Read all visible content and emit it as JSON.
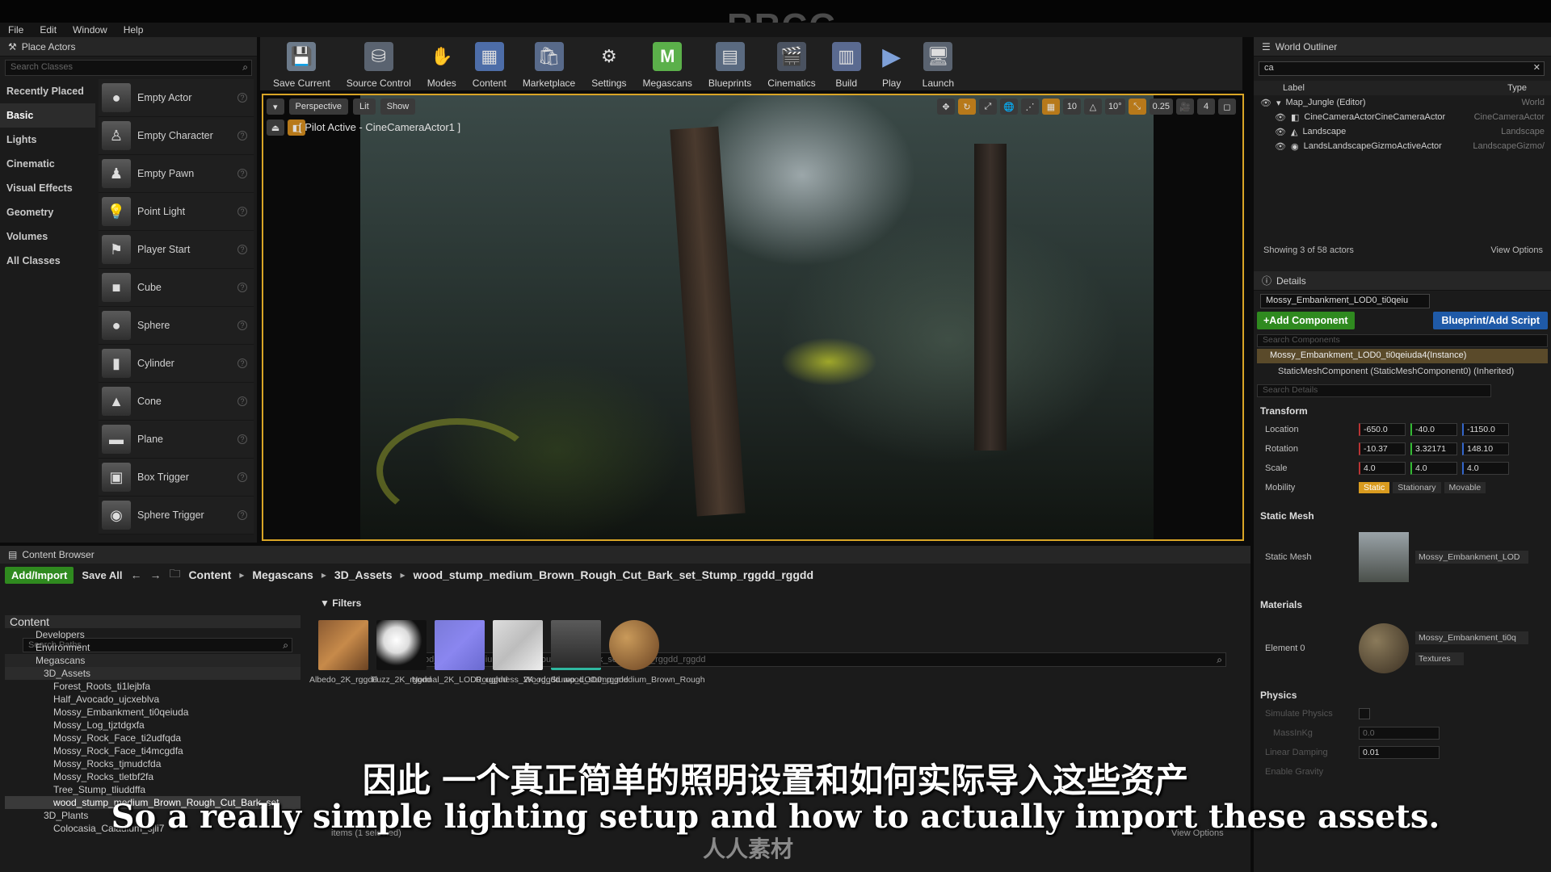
{
  "watermark": {
    "top": "RRCG",
    "bottom": "人人素材"
  },
  "menu": [
    "File",
    "Edit",
    "Window",
    "Help"
  ],
  "place_actors": {
    "title": "Place Actors",
    "search_placeholder": "Search Classes",
    "categories": [
      "Recently Placed",
      "Basic",
      "Lights",
      "Cinematic",
      "Visual Effects",
      "Geometry",
      "Volumes",
      "All Classes"
    ],
    "selected_category": "Basic",
    "actors": [
      "Empty Actor",
      "Empty Character",
      "Empty Pawn",
      "Point Light",
      "Player Start",
      "Cube",
      "Sphere",
      "Cylinder",
      "Cone",
      "Plane",
      "Box Trigger",
      "Sphere Trigger"
    ]
  },
  "toolbar": [
    "Save Current",
    "Source Control",
    "Modes",
    "Content",
    "Marketplace",
    "Settings",
    "Megascans",
    "Blueprints",
    "Cinematics",
    "Build",
    "Play",
    "Launch"
  ],
  "viewport": {
    "buttons": [
      "Perspective",
      "Lit",
      "Show"
    ],
    "pilot_text": "[ Pilot Active - CineCameraActor1 ]",
    "right_values": [
      "10",
      "10°",
      "0.25",
      "4"
    ]
  },
  "outliner": {
    "title": "World Outliner",
    "search_value": "ca",
    "col_label": "Label",
    "col_type": "Type",
    "rows": [
      {
        "label": "Map_Jungle (Editor)",
        "type": "World"
      },
      {
        "label": "CineCameraActorCineCameraActor",
        "type": "CineCameraActor"
      },
      {
        "label": "Landscape",
        "type": "Landscape"
      },
      {
        "label": "LandsLandscapeGizmoActiveActor",
        "type": "LandscapeGizmo/"
      }
    ],
    "footer": "Showing 3 of 58 actors",
    "view_options": "View Options"
  },
  "details": {
    "title": "Details",
    "name_field": "Mossy_Embankment_LOD0_ti0qeiu",
    "add_component": "+Add Component",
    "blueprint_script": "Blueprint/Add Script",
    "search_components": "Search Components",
    "instance": "Mossy_Embankment_LOD0_ti0qeiuda4(Instance)",
    "component": "StaticMeshComponent (StaticMeshComponent0) (Inherited)",
    "search_details": "Search Details",
    "transform_label": "Transform",
    "location_label": "Location",
    "rotation_label": "Rotation",
    "scale_label": "Scale",
    "mobility_label": "Mobility",
    "location": [
      "-650.0",
      "-40.0",
      "-1150.0"
    ],
    "rotation": [
      "-10.37",
      "3.32171",
      "148.10"
    ],
    "scale": [
      "4.0",
      "4.0",
      "4.0"
    ],
    "mobility": [
      "Static",
      "Stationary",
      "Movable"
    ],
    "static_mesh_section": "Static Mesh",
    "static_mesh_label": "Static Mesh",
    "static_mesh_value": "Mossy_Embankment_LOD",
    "materials_section": "Materials",
    "element0_label": "Element 0",
    "element0_value": "Mossy_Embankment_ti0q",
    "textures": "Textures",
    "physics_section": "Physics",
    "simulate_physics": "Simulate Physics",
    "mass_label": "MassInKg",
    "mass_value": "0.0",
    "linear_damping_label": "Linear Damping",
    "linear_damping_value": "0.01",
    "enable_gravity": "Enable Gravity"
  },
  "content_browser": {
    "title": "Content Browser",
    "add_import": "Add/Import",
    "save_all": "Save All",
    "breadcrumb": [
      "Content",
      "Megascans",
      "3D_Assets",
      "wood_stump_medium_Brown_Rough_Cut_Bark_set_Stump_rggdd_rggdd"
    ],
    "search_paths": "Search Paths",
    "filters": "Filters",
    "search_assets": "Search wood_stump_medium_Brown_Rough_Cut_Bark_set_Stump_rggdd_rggdd",
    "tree": [
      "Content",
      "Developers",
      "Environment",
      "Megascans",
      "3D_Assets",
      "Forest_Roots_ti1lejbfa",
      "Half_Avocado_ujcxeblva",
      "Mossy_Embankment_ti0qeiuda",
      "Mossy_Log_tjztdgxfa",
      "Mossy_Rock_Face_ti2udfqda",
      "Mossy_Rock_Face_ti4mcgdfa",
      "Mossy_Rocks_tjmudcfda",
      "Mossy_Rocks_tletbf2fa",
      "Tree_Stump_tliuddffa",
      "wood_stump_medium_Brown_Rough_Cut_Bark_set",
      "3D_Plants",
      "Colocasia_Caladium_sjli7"
    ],
    "assets": [
      "Albedo_2K_rggdd",
      "Fuzz_2K_rggdd",
      "Normal_2K_LOD0_rggdd",
      "Roughness_2K_rggdd",
      "Wood_Stump_LOD0_rggdd",
      "wood_stump_medium_Brown_Rough"
    ],
    "items_selected": "items (1 selected)",
    "view_options": "View Options"
  },
  "subtitles": {
    "cn": "因此 一个真正简单的照明设置和如何实际导入这些资产",
    "en": "So a really simple lighting setup and how to actually import these assets."
  }
}
